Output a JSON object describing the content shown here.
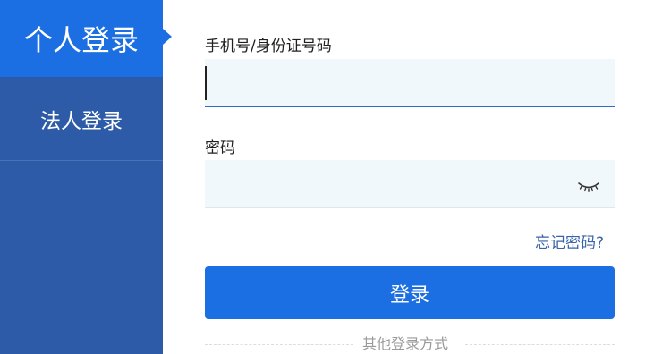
{
  "sidebar": {
    "tabs": [
      {
        "label": "个人登录",
        "active": true
      },
      {
        "label": "法人登录",
        "active": false
      }
    ]
  },
  "form": {
    "phone_label": "手机号/身份证号码",
    "phone_value": "",
    "password_label": "密码",
    "password_value": "",
    "password_toggle_icon": "eye-closed-icon",
    "forgot_link": "忘记密码?",
    "login_button": "登录",
    "other_methods": "其他登录方式"
  },
  "colors": {
    "sidebar_bg": "#2d5ba8",
    "active_tab_bg": "#1b6fe3",
    "primary_button": "#1b6fe3",
    "input_bg": "#f1f8fb",
    "link": "#3a62a8"
  }
}
